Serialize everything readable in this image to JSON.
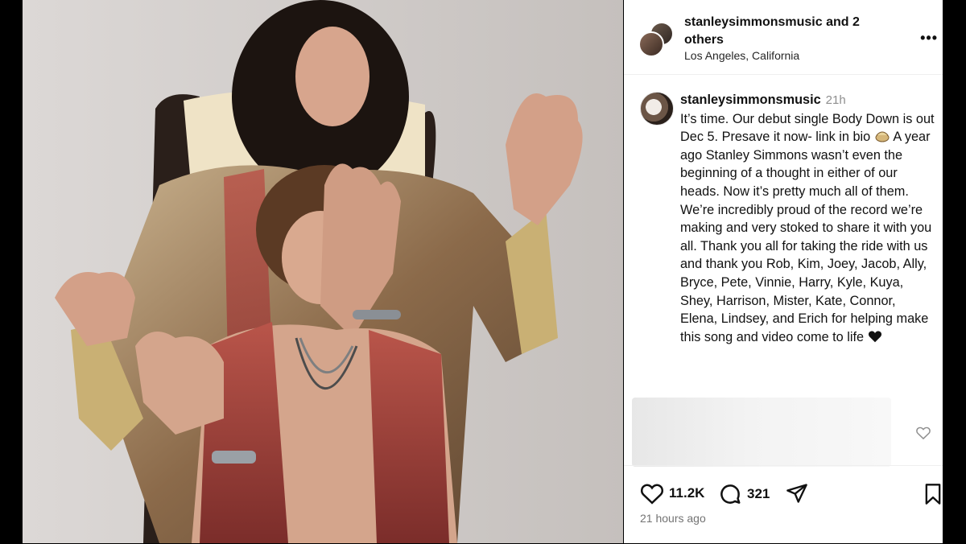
{
  "post": {
    "header": {
      "usernames": "stanleysimmonsmusic",
      "others": " and 2 others",
      "location": "Los Angeles, California",
      "more_icon": "more-horizontal-icon"
    },
    "caption": {
      "username": "stanleysimmonsmusic",
      "time": "21h",
      "text_part1": " It’s time. Our debut single Body Down is out Dec 5. Presave it now- link in bio ",
      "text_part2": " A year ago Stanley Simmons wasn’t even the beginning of a thought in either of our heads. Now it’s pretty much all of them. We’re incredibly proud of the record we’re making and very stoked to share it with you all. Thank you all for taking the ride with us and thank you Rob, Kim, Joey, Jacob, Ally, Bryce, Pete, Vinnie, Harry, Kyle, Kuya, Shey, Harrison, Mister, Kate, Connor, Elena, Lindsey, and Erich for helping make this song and video come to life ",
      "emoji_icon": "sparkles-emoji-icon",
      "heart_emoji": "black-heart-emoji-icon"
    },
    "actions": {
      "likes": "11.2K",
      "comments": "321",
      "time_ago": "21 hours ago",
      "icons": [
        "heart-icon",
        "comment-icon",
        "share-icon",
        "bookmark-icon"
      ]
    }
  },
  "colors": {
    "panel_bg": "#ffffff",
    "text": "#111111",
    "muted": "#8e8e8e"
  }
}
